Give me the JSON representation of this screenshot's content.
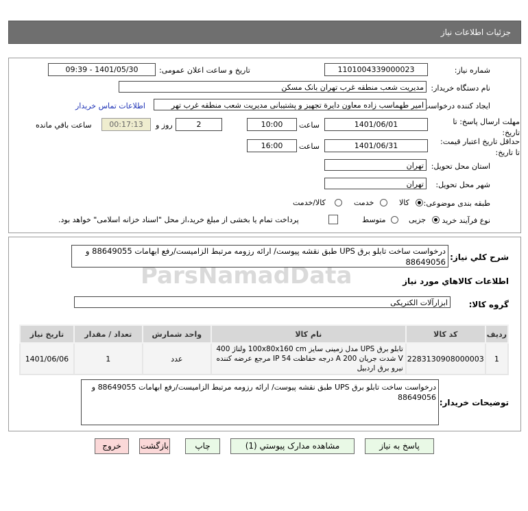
{
  "header": {
    "title": "جزئیات اطلاعات نیاز"
  },
  "watermark": "ParsNamadData",
  "form": {
    "need_number_label": "شماره نیاز:",
    "need_number": "1101004339000023",
    "announce_label": "تاریخ و ساعت اعلان عمومی:",
    "announce_value": "1401/05/30 - 09:39",
    "buyer_label": "نام دستگاه خریدار:",
    "buyer": "مدیریت شعب منطقه غرب تهران بانک مسکن",
    "creator_label": "ایجاد کننده درخواست:",
    "creator": "امیر طهماسب زاده معاون دایرة تجهیز و پشتیبانی مدیریت شعب منطقه غرب تهر",
    "contact_link": "اطلاعات تماس خریدار",
    "deadline_label": "مهلت ارسال پاسخ: تا تاریخ:",
    "deadline_date": "1401/06/01",
    "time_label": "ساعت",
    "deadline_time": "10:00",
    "days": "2",
    "days_label": "روز و",
    "countdown": "00:17:13",
    "remaining_label": "ساعت باقي مانده",
    "validity_label": "حداقل تاریخ اعتبار قیمت: تا تاریخ:",
    "validity_date": "1401/06/31",
    "validity_time": "16:00",
    "province_label": "استان محل تحویل:",
    "province": "تهران",
    "city_label": "شهر محل تحویل:",
    "city": "تهران",
    "category_label": "طبقه بندی موضوعی:",
    "category_options": [
      "کالا",
      "خدمت",
      "کالا/خدمت"
    ],
    "category_selected": "کالا",
    "process_label": "نوع فرآیند خرید :",
    "process_options": [
      "جزیی",
      "متوسط"
    ],
    "process_selected": "جزیی",
    "payment_note": "پرداخت تمام یا بخشی از مبلغ خرید،از محل \"اسناد خزانه اسلامی\" خواهد بود.",
    "payment_checked": false
  },
  "details": {
    "summary_label": "شرح کلي نياز:",
    "summary": "درخواست ساخت تابلو برق UPS طبق نقشه پیوست/ ارائه رزومه مرتبط الزامیست/رفع ابهامات 88649055 و 88649056",
    "goods_heading": "اطلاعات کالاهاي مورد نياز",
    "group_label": "گروه کالا:",
    "group": "ابزارآلات الکتریکی",
    "table": {
      "headers": [
        "ردیف",
        "کد کالا",
        "نام کالا",
        "واحد شمارش",
        "تعداد / مقدار",
        "تاریخ نیاز"
      ],
      "rows": [
        [
          "1",
          "2283130908000003",
          "تابلو برق UPS مدل زمینی سایز 100x80x160 cm ولتاژ 400 V شدت جریان 200 A درجه حفاظت IP 54 مرجع عرضه کننده نیرو برق اردبیل",
          "عدد",
          "1",
          "1401/06/06"
        ]
      ]
    },
    "buyer_notes_label": "توضیحات خریدار:",
    "buyer_notes": "درخواست ساخت تابلو برق UPS طبق نقشه پیوست/ ارائه رزومه مرتبط الزامیست/رفع ابهامات 88649055 و 88649056"
  },
  "buttons": {
    "reply": "پاسخ به نیاز",
    "attachments": "مشاهده مدارک پیوستي (1)",
    "print": "چاپ",
    "back": "بازگشت",
    "exit": "خروج"
  }
}
